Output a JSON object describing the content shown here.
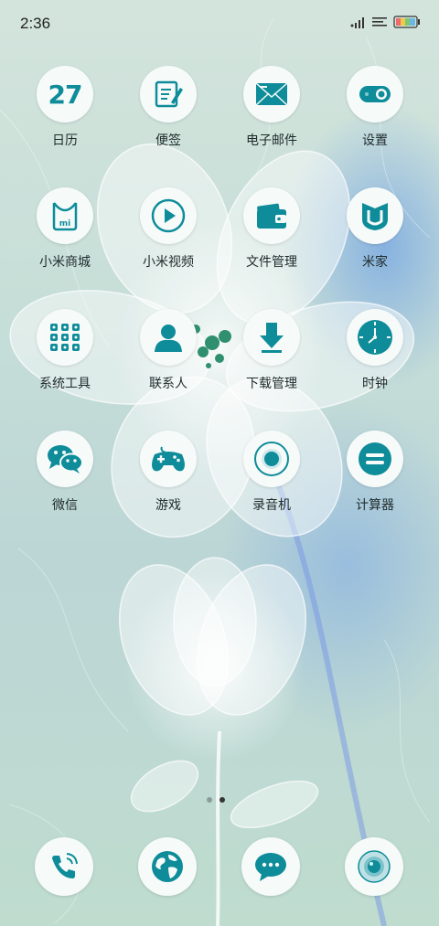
{
  "status_bar": {
    "time": "2:36"
  },
  "colors": {
    "icon_teal": "#0e8c99",
    "icon_bg": "#f6fbfa",
    "label": "#1f2b2b"
  },
  "apps": [
    {
      "label": "日历",
      "icon": "calendar-icon",
      "day": "27"
    },
    {
      "label": "便签",
      "icon": "notes-icon"
    },
    {
      "label": "电子邮件",
      "icon": "email-icon"
    },
    {
      "label": "设置",
      "icon": "settings-toggle-icon"
    },
    {
      "label": "小米商城",
      "icon": "shopping-bag-icon",
      "badge": "mi"
    },
    {
      "label": "小米视频",
      "icon": "play-icon"
    },
    {
      "label": "文件管理",
      "icon": "wallet-folder-icon"
    },
    {
      "label": "米家",
      "icon": "mijia-icon"
    },
    {
      "label": "系统工具",
      "icon": "tools-grid-icon"
    },
    {
      "label": "联系人",
      "icon": "contact-icon"
    },
    {
      "label": "下载管理",
      "icon": "download-icon"
    },
    {
      "label": "时钟",
      "icon": "clock-icon"
    },
    {
      "label": "微信",
      "icon": "wechat-icon"
    },
    {
      "label": "游戏",
      "icon": "gamepad-icon"
    },
    {
      "label": "录音机",
      "icon": "recorder-icon"
    },
    {
      "label": "计算器",
      "icon": "calculator-icon"
    }
  ],
  "dock": [
    {
      "icon": "phone-icon"
    },
    {
      "icon": "browser-globe-icon"
    },
    {
      "icon": "messages-icon"
    },
    {
      "icon": "camera-icon"
    }
  ],
  "pages": {
    "count": 2,
    "active": 2
  }
}
